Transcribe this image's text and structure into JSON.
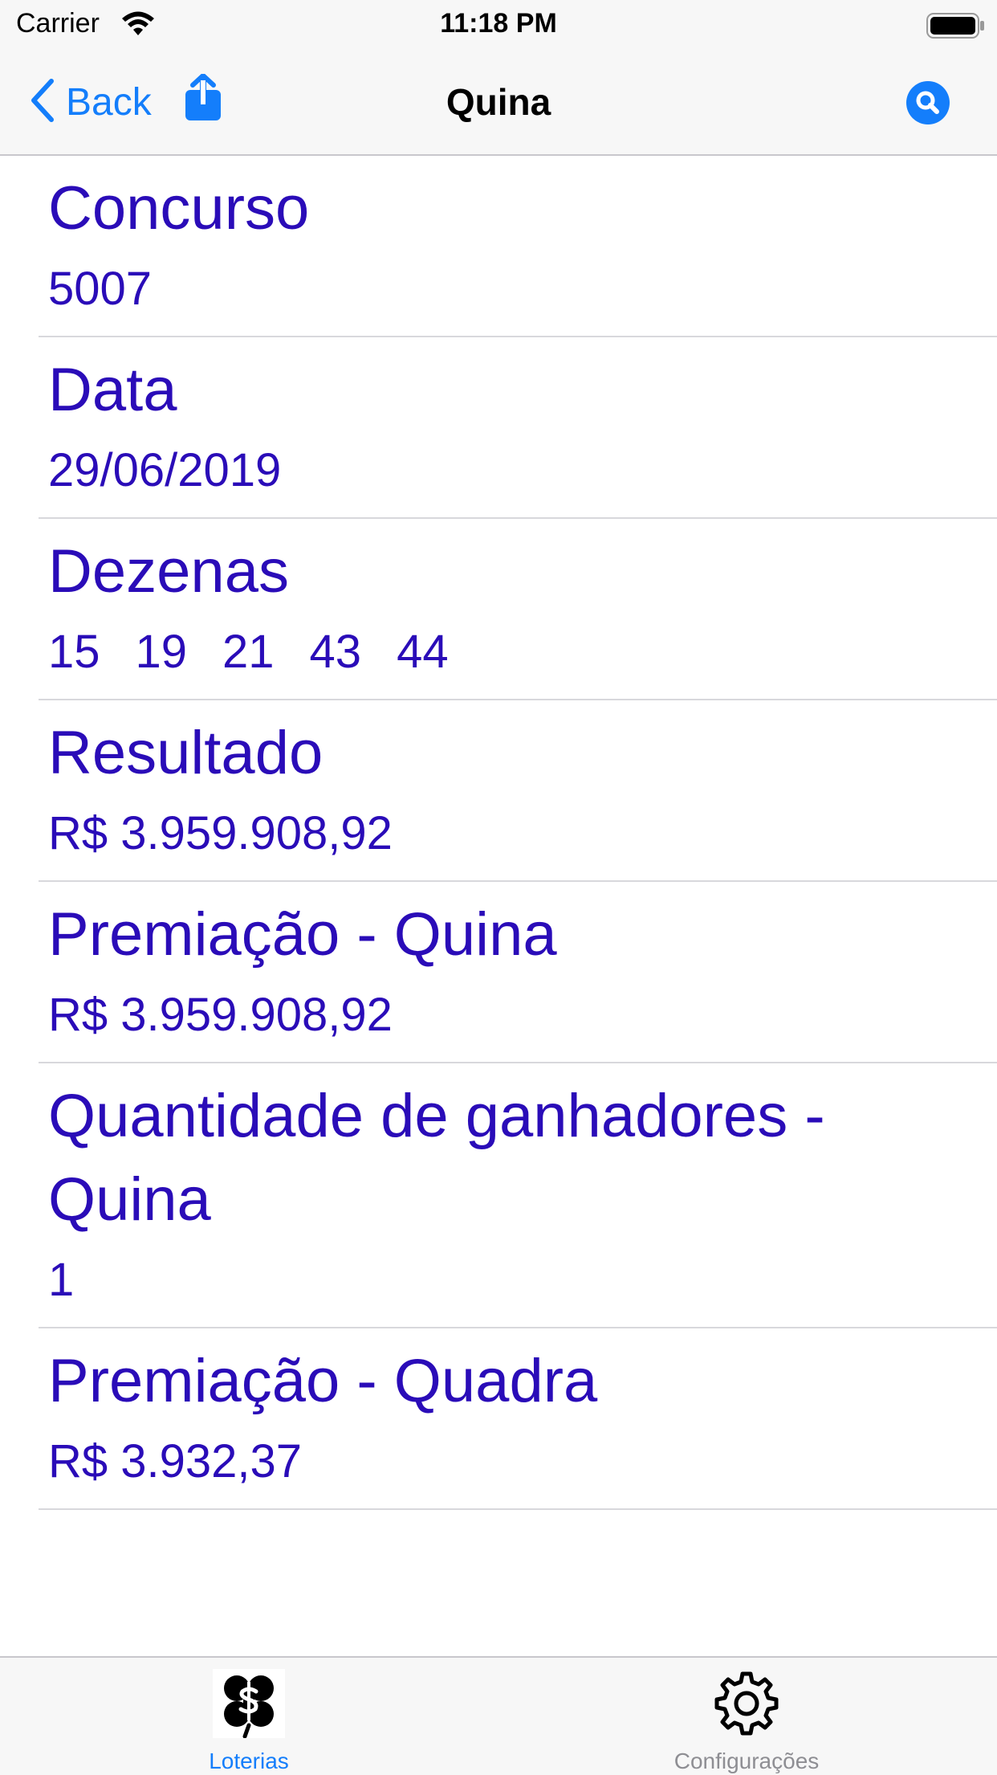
{
  "status_bar": {
    "carrier": "Carrier",
    "time": "11:18 PM"
  },
  "nav": {
    "back_label": "Back",
    "title": "Quina",
    "share_icon": "share-icon",
    "search_icon": "search-icon"
  },
  "rows": [
    {
      "title": "Concurso",
      "value": "5007"
    },
    {
      "title": "Data",
      "value": "29/06/2019"
    },
    {
      "title": "Dezenas",
      "numbers": [
        "15",
        "19",
        "21",
        "43",
        "44"
      ]
    },
    {
      "title": "Resultado",
      "value": "R$ 3.959.908,92"
    },
    {
      "title": "Premiação - Quina",
      "value": "R$ 3.959.908,92"
    },
    {
      "title": "Quantidade de ganhadores - Quina",
      "value": "1"
    },
    {
      "title": "Premiação - Quadra",
      "value": "R$ 3.932,37"
    }
  ],
  "tabs": [
    {
      "label": "Loterias",
      "icon": "lottery-clover-icon",
      "active": true
    },
    {
      "label": "Configurações",
      "icon": "gear-icon",
      "active": false
    }
  ],
  "colors": {
    "accent": "#147efb",
    "text_value": "#2a0cb8",
    "bar_background": "#f7f7f7"
  }
}
